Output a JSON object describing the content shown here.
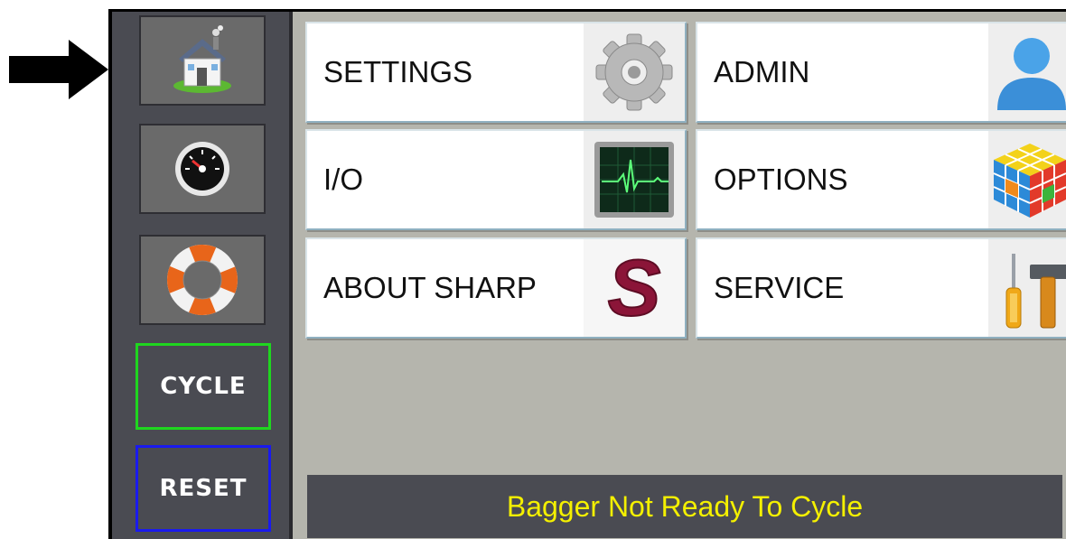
{
  "sidebar": {
    "home_icon": "home-icon",
    "dashboard_icon": "gauge-icon",
    "help_icon": "lifebuoy-icon",
    "cycle_label": "CYCLE",
    "reset_label": "RESET"
  },
  "menu": {
    "tiles": [
      {
        "label": "SETTINGS",
        "icon": "gear-icon"
      },
      {
        "label": "ADMIN",
        "icon": "user-icon"
      },
      {
        "label": "I/O",
        "icon": "monitor-icon"
      },
      {
        "label": "OPTIONS",
        "icon": "cube-icon"
      },
      {
        "label": "ABOUT SHARP",
        "icon": "sharp-logo-icon",
        "logo_letter": "S"
      },
      {
        "label": "SERVICE",
        "icon": "tools-icon"
      }
    ]
  },
  "status": {
    "message": "Bagger Not Ready To Cycle"
  },
  "colors": {
    "sidebar": "#4a4b52",
    "panel": "#b5b5ad",
    "cycle_border": "#1fd61f",
    "reset_border": "#1a1aee",
    "status_text": "#f4f000",
    "logo": "#8b1538"
  }
}
